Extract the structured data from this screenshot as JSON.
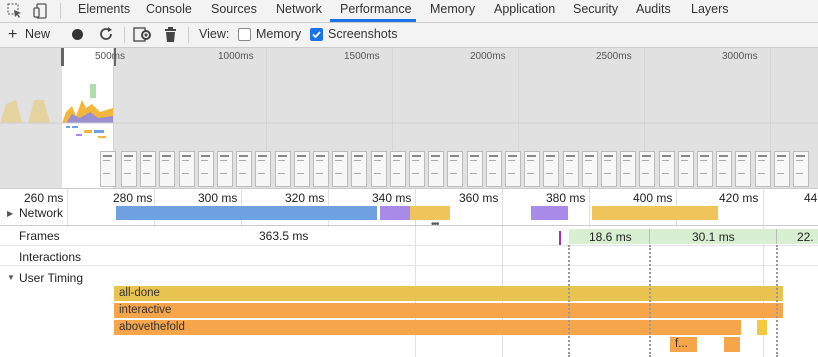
{
  "tabs": [
    "Elements",
    "Console",
    "Sources",
    "Network",
    "Performance",
    "Memory",
    "Application",
    "Security",
    "Audits",
    "Layers"
  ],
  "active_tab": "Performance",
  "toolbar": {
    "new_label": "New",
    "view_label": "View:",
    "memory_label": "Memory",
    "memory_checked": false,
    "screenshots_label": "Screenshots",
    "screenshots_checked": true
  },
  "overview": {
    "tick_labels": [
      "500ms",
      "1000ms",
      "1500ms",
      "2000ms",
      "2500ms",
      "3000ms"
    ]
  },
  "ruler": {
    "labels": [
      "260 ms",
      "280 ms",
      "300 ms",
      "320 ms",
      "340 ms",
      "360 ms",
      "380 ms",
      "400 ms",
      "420 ms",
      "44"
    ]
  },
  "network": {
    "label": "Network"
  },
  "frames": {
    "label": "Frames",
    "values": [
      "363.5 ms",
      "18.6 ms",
      "30.1 ms",
      "22."
    ]
  },
  "interactions": {
    "label": "Interactions"
  },
  "user_timing": {
    "label": "User Timing",
    "marks": [
      "all-done",
      "interactive",
      "abovethefold",
      "f..."
    ]
  },
  "colors": {
    "network_blue": "#6fa0e0",
    "network_purple": "#a88be8",
    "network_yellow": "#efc45a",
    "timing_yellow": "#e8c34f",
    "timing_orange": "#f7a54a",
    "frame_green": "#d8efd2",
    "accent": "#1a73e8"
  }
}
